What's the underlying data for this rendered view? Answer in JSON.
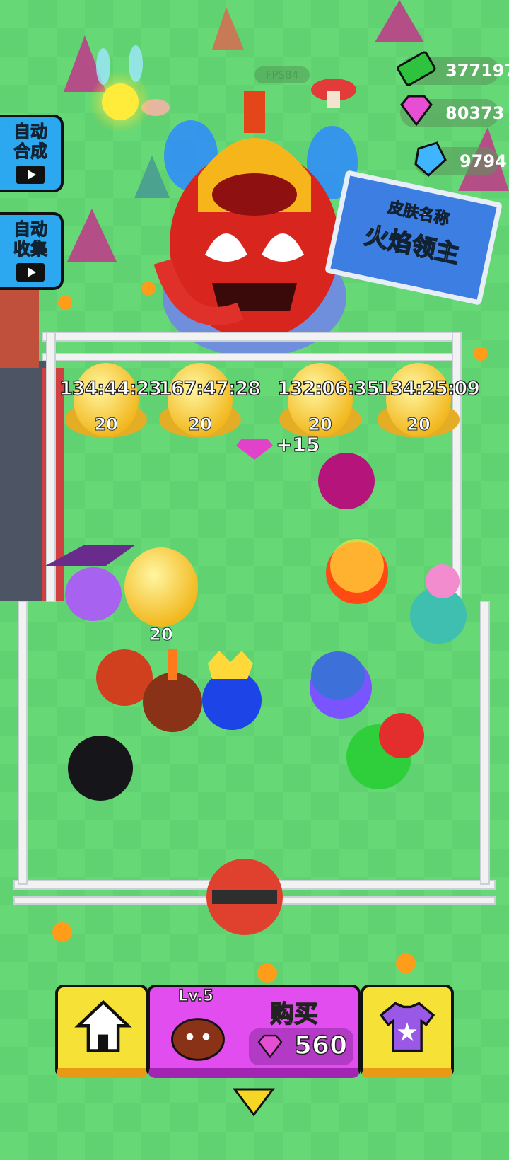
{
  "hud": {
    "fps": "FPS84",
    "cash": "377197",
    "pink_gems": "80373",
    "blue_gems": "9794",
    "cash_icon": "cash-icon",
    "pink_gem_icon": "pink-gem-icon",
    "blue_gem_icon": "blue-gem-icon"
  },
  "side_buttons": {
    "auto_merge": "自动合成",
    "auto_merge_line1": "自动",
    "auto_merge_line2": "合成",
    "auto_collect_line1": "自动",
    "auto_collect_line2": "收集"
  },
  "sign": {
    "caption": "皮肤名称",
    "skin_name": "火焰领主"
  },
  "nests": [
    {
      "timer": "134:44:23",
      "level": "20"
    },
    {
      "timer": "167:47:28",
      "level": "20"
    },
    {
      "timer": "132:06:35",
      "level": "20"
    },
    {
      "timer": "134:25:09",
      "level": "20"
    }
  ],
  "loose_egg_level": "20",
  "gem_bonus": "+15",
  "bottom": {
    "buy_label": "购买",
    "buy_price": "560",
    "pet_level": "Lv.5",
    "home_icon": "home-icon",
    "skin_icon": "shirt-icon"
  },
  "colors": {
    "grass": "#5fd16f",
    "accent_yellow": "#f6e137",
    "accent_pink": "#e24df0",
    "hud_blue": "#2ba8f0"
  }
}
